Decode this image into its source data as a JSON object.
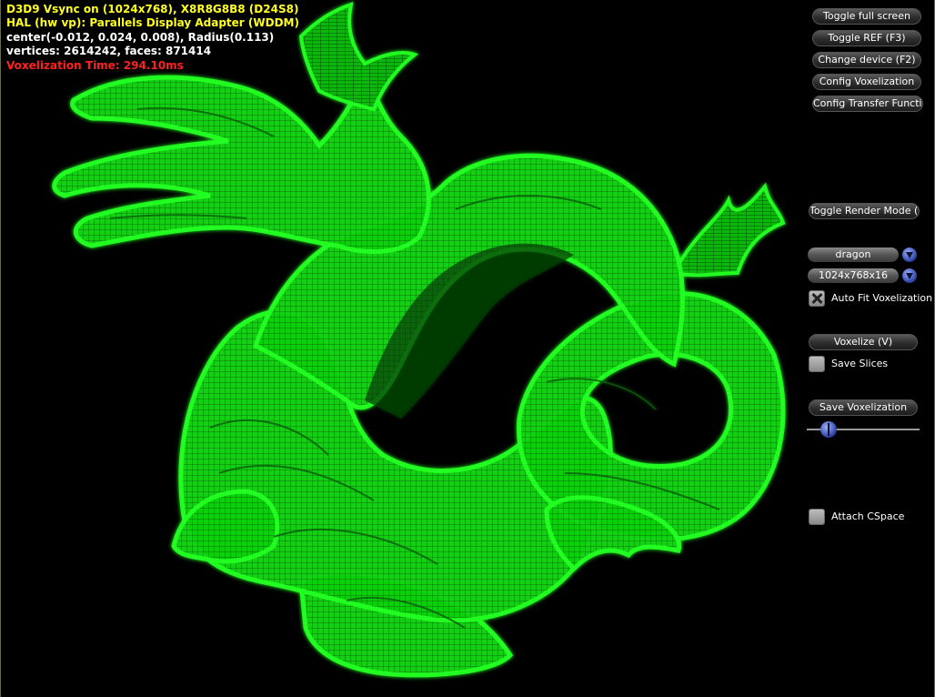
{
  "stats": {
    "line1": "D3D9 Vsync on (1024x768), X8R8G8B8 (D24S8)",
    "line2": "HAL (hw vp): Parallels Display Adapter (WDDM)",
    "line3": "center(-0.012, 0.024, 0.008), Radius(0.113)",
    "line4": "vertices: 2614242, faces: 871414",
    "line5": "Voxelization Time: 294.10ms"
  },
  "buttons": {
    "toggle_full_screen": "Toggle full screen",
    "toggle_ref": "Toggle REF (F3)",
    "change_device": "Change device (F2)",
    "config_voxelization": "Config Voxelization",
    "config_transfer_function": "Config Transfer Function",
    "toggle_render_mode": "Toggle Render Mode (M)",
    "voxelize": "Voxelize (V)",
    "save_voxelization": "Save Voxelization"
  },
  "combos": {
    "model": "dragon",
    "resolution": "1024x768x16"
  },
  "checkboxes": {
    "auto_fit": {
      "label": "Auto Fit Voxelization Bo",
      "checked": true
    },
    "save_slices": {
      "label": "Save Slices",
      "checked": false
    },
    "attach_cspace": {
      "label": "Attach CSpace",
      "checked": false
    }
  },
  "slider": {
    "value": 0.19
  },
  "colors": {
    "voxel_green": "#00ff00",
    "stat_yellow": "#ffff20",
    "stat_red": "#ff2020"
  },
  "icons": {
    "combo_arrow": "chevron-down-icon",
    "slider_thumb": "slider-thumb-icon"
  }
}
